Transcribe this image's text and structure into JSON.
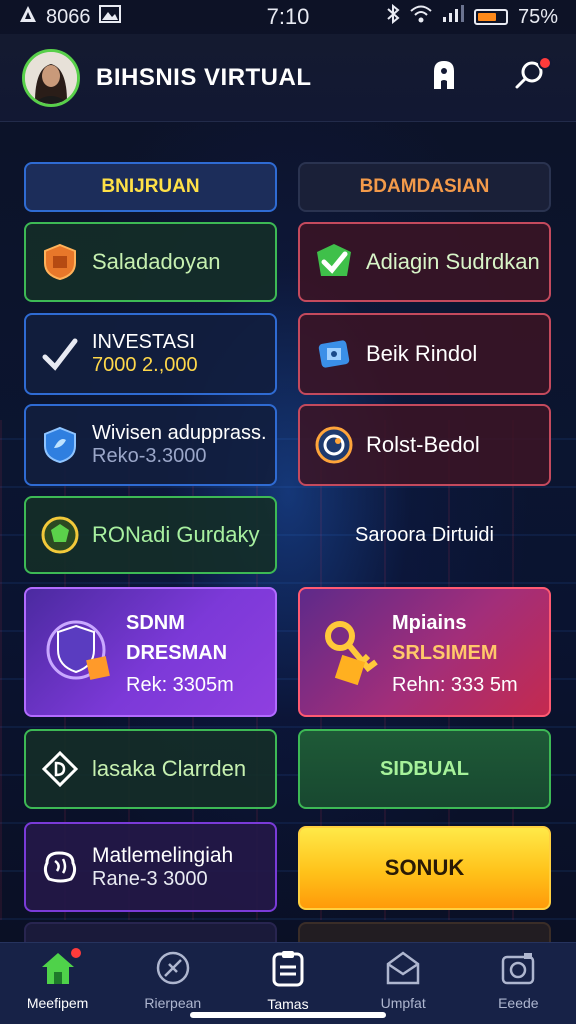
{
  "status_bar": {
    "left_text": "8066",
    "time": "7:10",
    "battery_percent": "75%"
  },
  "header": {
    "title": "BIHSNIS VIRTUAL"
  },
  "tabs": [
    {
      "label": "BNIJRUAN"
    },
    {
      "label": "BDAMDASIAN"
    }
  ],
  "cards": {
    "left": [
      {
        "title": "Saladadoyan",
        "icon": "shield-box-icon"
      },
      {
        "title": "INVESTASI",
        "sub": "7000 2.,000",
        "icon": "checkmark-icon"
      },
      {
        "title": "Wivisen adupprass.",
        "sub": "Reko-3.3000",
        "icon": "shield-leaf-icon"
      },
      {
        "title": "RONadi Gurdaky",
        "icon": "gear-badge-icon"
      },
      {
        "title": "SDNM",
        "title2": "DRESMAN",
        "sub": "Rek: 3305m",
        "icon": "shield-cube-icon"
      },
      {
        "title": "lasaka Clarrden",
        "icon": "diamond-icon"
      },
      {
        "title": "Matlemelingiah",
        "sub": "Rane-3 3000",
        "icon": "brain-icon"
      }
    ],
    "right": [
      {
        "title": "Adiagin Sudrdkan",
        "icon": "green-check-icon"
      },
      {
        "title": "Beik Rindol",
        "icon": "robot-icon"
      },
      {
        "title": "Rolst-Bedol",
        "icon": "orbit-icon"
      },
      {
        "title": "Saroora Dirtuidi"
      },
      {
        "title": "Mpiains",
        "title2": "SRLSIMEM",
        "sub": "Rehn: 333 5m",
        "icon": "keys-icon"
      },
      {
        "title": "SIDBUAL"
      },
      {
        "title": "SONUK"
      }
    ]
  },
  "bottom_nav": [
    {
      "label": "Meefipem",
      "icon": "home-icon",
      "active": true,
      "badge": true
    },
    {
      "label": "Rierpean",
      "icon": "compass-icon"
    },
    {
      "label": "Tamas",
      "icon": "clipboard-icon",
      "active": true
    },
    {
      "label": "Umpfat",
      "icon": "inbox-icon"
    },
    {
      "label": "Eeede",
      "icon": "camera-icon"
    }
  ],
  "colors": {
    "accent_green": "#3db955",
    "accent_purple": "#8f3fe0",
    "accent_yellow": "#ffd040",
    "nav_bg": "#172247"
  }
}
